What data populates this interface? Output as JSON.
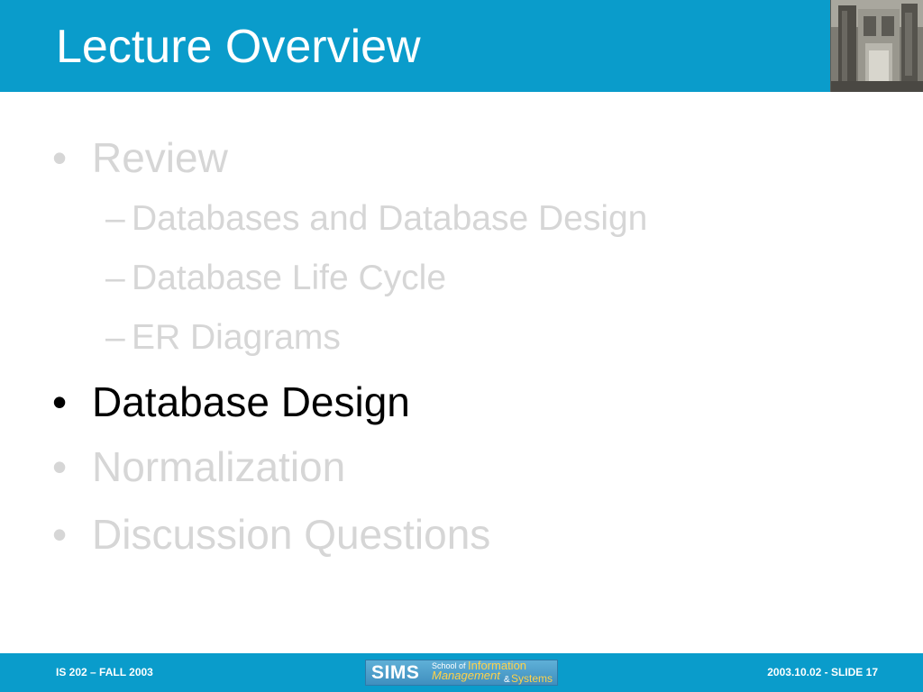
{
  "slide": {
    "title": "Lecture Overview",
    "bullets": [
      {
        "marker": "•",
        "text": "Review",
        "state": "dim"
      },
      {
        "marker": "–",
        "text": "Databases and Database Design",
        "state": "dim"
      },
      {
        "marker": "–",
        "text": "Database Life Cycle",
        "state": "dim"
      },
      {
        "marker": "–",
        "text": "ER Diagrams",
        "state": "dim"
      },
      {
        "marker": "•",
        "text": "Database Design",
        "state": "active"
      },
      {
        "marker": "•",
        "text": "Normalization",
        "state": "dim"
      },
      {
        "marker": "•",
        "text": "Discussion Questions",
        "state": "dim"
      }
    ]
  },
  "footer": {
    "course": "IS 202 – FALL 2003",
    "slide_info": "2003.10.02 - SLIDE 17",
    "logo": {
      "acronym": "SIMS",
      "school_of": "School of",
      "information": "Information",
      "management": "Management",
      "amp": "&",
      "systems": "Systems"
    }
  },
  "colors": {
    "band": "#0a9ccb",
    "active_text": "#000000",
    "dim_text": "#d6d6d6",
    "logo_accent": "#ffd24a"
  },
  "icons": {
    "header_photo": "building-photo-icon"
  }
}
